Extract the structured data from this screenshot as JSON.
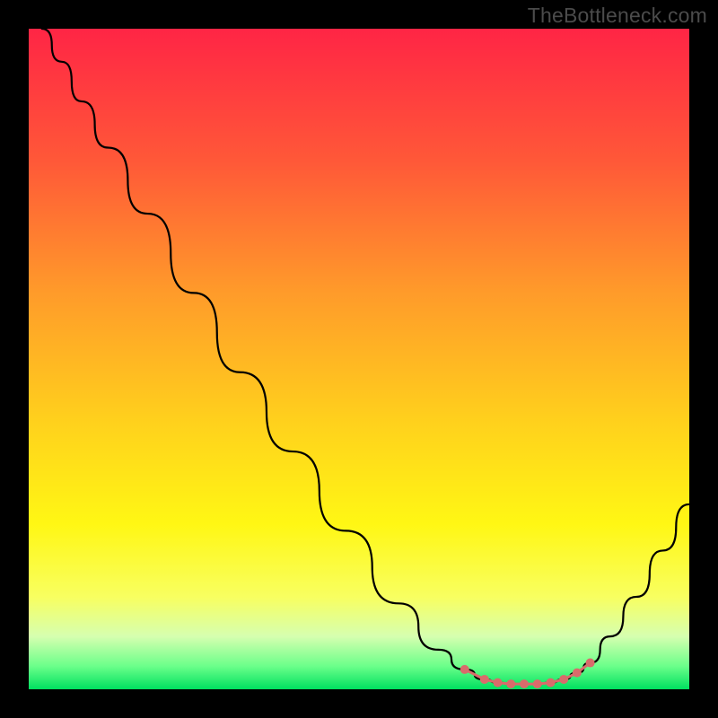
{
  "watermark": "TheBottleneck.com",
  "chart_data": {
    "type": "line",
    "title": "",
    "xlabel": "",
    "ylabel": "",
    "xlim": [
      0,
      100
    ],
    "ylim": [
      0,
      100
    ],
    "grid": false,
    "legend": false,
    "gradient_stops": [
      {
        "offset": 0.0,
        "color": "#ff2545"
      },
      {
        "offset": 0.2,
        "color": "#ff5838"
      },
      {
        "offset": 0.4,
        "color": "#ff9b2a"
      },
      {
        "offset": 0.6,
        "color": "#ffd21c"
      },
      {
        "offset": 0.75,
        "color": "#fff714"
      },
      {
        "offset": 0.86,
        "color": "#f8ff60"
      },
      {
        "offset": 0.92,
        "color": "#d6ffb0"
      },
      {
        "offset": 0.965,
        "color": "#6bff8a"
      },
      {
        "offset": 1.0,
        "color": "#00e060"
      }
    ],
    "series": [
      {
        "name": "bottleneck-curve",
        "stroke": "#000000",
        "stroke_width": 2.2,
        "x": [
          2,
          5,
          8,
          12,
          18,
          25,
          32,
          40,
          48,
          56,
          62,
          66,
          69,
          71,
          73,
          75,
          77,
          79,
          81,
          83,
          85,
          88,
          92,
          96,
          100
        ],
        "y": [
          100,
          95,
          89,
          82,
          72,
          60,
          48,
          36,
          24,
          13,
          6,
          3,
          1.5,
          1,
          0.8,
          0.8,
          0.8,
          1,
          1.5,
          2.5,
          4,
          8,
          14,
          21,
          28
        ]
      },
      {
        "name": "optimal-zone-markers",
        "type": "scatter",
        "stroke": "#d96b6b",
        "fill": "#d96b6b",
        "marker_r": 5,
        "x": [
          66,
          69,
          71,
          73,
          75,
          77,
          79,
          81,
          83,
          85
        ],
        "y": [
          3,
          1.5,
          1.0,
          0.8,
          0.8,
          0.8,
          1.0,
          1.5,
          2.5,
          4
        ]
      }
    ]
  }
}
